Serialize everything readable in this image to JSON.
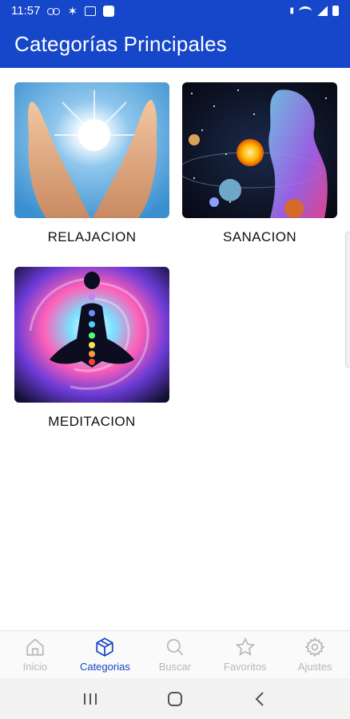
{
  "status_bar": {
    "time": "11:57"
  },
  "app_bar": {
    "title": "Categorías Principales"
  },
  "categories": [
    {
      "label": "RELAJACION",
      "image": "hands-sun-image"
    },
    {
      "label": "SANACION",
      "image": "cosmic-woman-image"
    },
    {
      "label": "MEDITACION",
      "image": "meditation-chakras-image"
    }
  ],
  "bottom_nav": {
    "items": [
      {
        "label": "Inicio",
        "icon": "home-icon",
        "active": false
      },
      {
        "label": "Categorias",
        "icon": "cube-icon",
        "active": true
      },
      {
        "label": "Buscar",
        "icon": "search-icon",
        "active": false
      },
      {
        "label": "Favoritos",
        "icon": "star-icon",
        "active": false
      },
      {
        "label": "Ajustes",
        "icon": "gear-icon",
        "active": false
      }
    ]
  },
  "colors": {
    "primary": "#1646c9",
    "inactive": "#b8b8b8",
    "text": "#111111"
  }
}
